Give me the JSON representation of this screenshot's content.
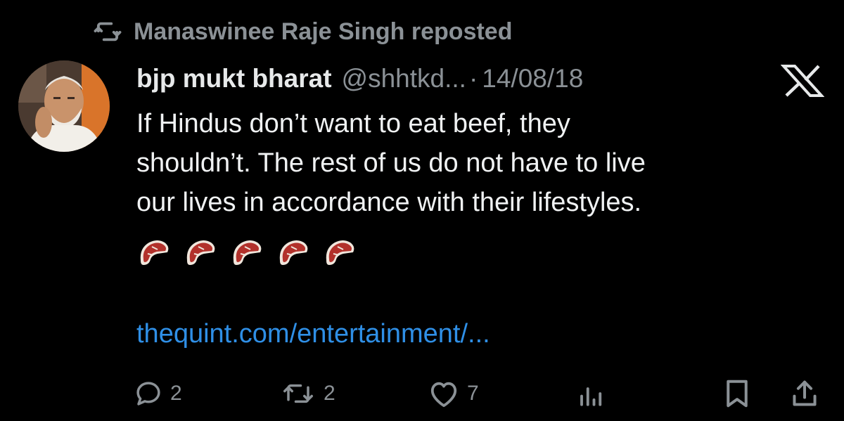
{
  "repost": {
    "text": "Manaswinee Raje Singh reposted",
    "icon": "repost-icon"
  },
  "tweet": {
    "display_name": "bjp mukt bharat",
    "handle": "@shhtkd...",
    "separator": "·",
    "date": "14/08/18",
    "avatar": "user-avatar",
    "body_lines": [
      "If Hindus don’t want to eat beef, they",
      "shouldn’t. The rest of us do not have to live",
      "our lives in accordance with their lifestyles."
    ],
    "emoji": [
      "steak-emoji",
      "steak-emoji",
      "steak-emoji",
      "steak-emoji",
      "steak-emoji"
    ],
    "link": "thequint.com/entertainment/..."
  },
  "actions": {
    "replies": "2",
    "reposts": "2",
    "likes": "7",
    "icons": [
      "reply-icon",
      "repost-icon",
      "like-icon",
      "views-icon",
      "bookmark-icon",
      "share-icon"
    ]
  },
  "colors": {
    "background": "#000000",
    "text": "#e7e9ea",
    "muted": "#8b9196",
    "link": "#2f8fe6"
  },
  "brand": {
    "logo": "x-logo-icon"
  }
}
